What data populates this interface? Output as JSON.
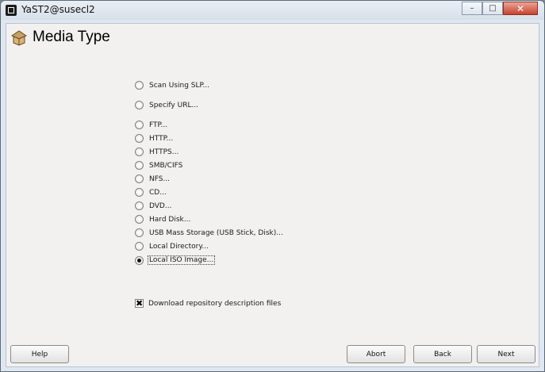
{
  "window": {
    "title": "YaST2@susecl2",
    "controls": [
      "–",
      "□",
      "✕"
    ]
  },
  "page": {
    "title": "Media Type"
  },
  "options": [
    {
      "label": "Scan Using SLP...",
      "checked": false
    },
    {
      "label": "Specify URL...",
      "checked": false
    },
    {
      "label": "FTP...",
      "checked": false
    },
    {
      "label": "HTTP...",
      "checked": false
    },
    {
      "label": "HTTPS...",
      "checked": false
    },
    {
      "label": "SMB/CIFS",
      "checked": false
    },
    {
      "label": "NFS...",
      "checked": false
    },
    {
      "label": "CD...",
      "checked": false
    },
    {
      "label": "DVD...",
      "checked": false
    },
    {
      "label": "Hard Disk...",
      "checked": false
    },
    {
      "label": "USB Mass Storage (USB Stick, Disk)...",
      "checked": false
    },
    {
      "label": "Local Directory...",
      "checked": false
    },
    {
      "label": "Local ISO Image...",
      "checked": true
    }
  ],
  "download_checkbox": {
    "label": "Download repository description files",
    "checked": true
  },
  "buttons": {
    "help": "Help",
    "abort": "Abort",
    "back": "Back",
    "next": "Next"
  }
}
